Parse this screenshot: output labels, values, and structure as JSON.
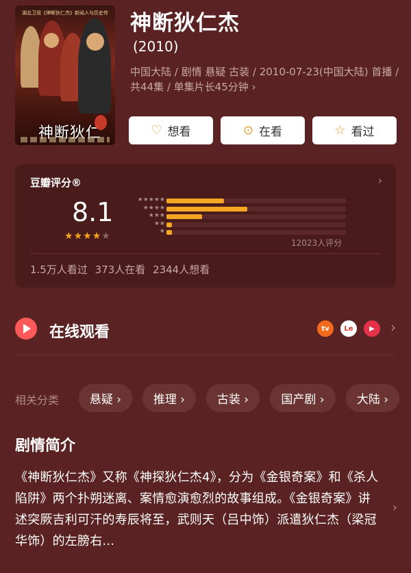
{
  "poster": {
    "top_text": "湖北卫视《神断狄仁杰》新闻人与历史传奇",
    "calligraphy": "神断狄仁傑"
  },
  "title": "神断狄仁杰",
  "year": "(2010)",
  "meta": "中国大陆 / 剧情 悬疑 古装 / 2010-07-23(中国大陆) 首播 / 共44集 / 单集片长45分钟 ›",
  "actions": {
    "want": "想看",
    "watching": "在看",
    "watched": "看过"
  },
  "rating": {
    "label": "豆瓣评分®",
    "score": "8.1",
    "stars_filled": 4,
    "stars_total": 5,
    "distribution": [
      {
        "stars": "★★★★★",
        "fraction": 0.32
      },
      {
        "stars": "★★★★",
        "fraction": 0.45
      },
      {
        "stars": "★★★",
        "fraction": 0.2
      },
      {
        "stars": "★★",
        "fraction": 0.03
      },
      {
        "stars": "★",
        "fraction": 0.03
      }
    ],
    "count": "12023人评分",
    "stats": "1.5万人看过  373人在看  2344人想看"
  },
  "online": {
    "label": "在线观看",
    "platforms": [
      "mango-tv-icon",
      "letv-icon",
      "tencent-video-icon"
    ]
  },
  "tags": {
    "label": "相关分类",
    "items": [
      "悬疑 ›",
      "推理 ›",
      "古装 ›",
      "国产剧 ›",
      "大陆 ›"
    ]
  },
  "synopsis": {
    "title": "剧情简介",
    "text": "《神断狄仁杰》又称《神探狄仁杰4》，分为《金银奇案》和《杀人陷阱》两个扑朔迷离、案情愈演愈烈的故事组成。《金银奇案》讲述突厥吉利可汗的寿辰将至，武则天（吕中饰）派遣狄仁杰（梁冠华饰）的左膀右..."
  },
  "colors": {
    "background": "#5a2222",
    "card": "#4a1b1b",
    "accent": "#f5a623",
    "play": "#ff5a5a"
  }
}
